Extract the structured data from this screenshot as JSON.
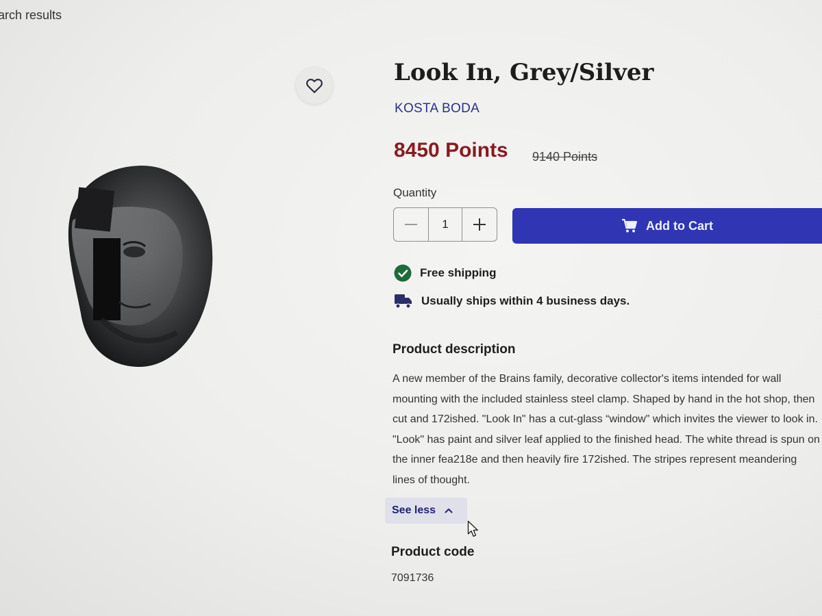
{
  "nav": {
    "back_label": "Back to search results"
  },
  "product": {
    "title": "Look In, Grey/Silver",
    "brand": "KOSTA BODA",
    "price": "8450 Points",
    "old_price": "9140 Points",
    "quantity_label": "Quantity",
    "quantity_value": "1",
    "add_to_cart_label": "Add to Cart",
    "shipping": [
      {
        "icon": "check-circle-icon",
        "text": "Free shipping"
      },
      {
        "icon": "truck-icon",
        "text": "Usually ships within 4 business days."
      }
    ],
    "description_heading": "Product description",
    "description": "A new member of the Brains family, decorative collector's items intended for wall mounting with the included stainless steel clamp. Shaped by hand in the hot shop, then cut and 172ished. \"Look In\" has a cut-glass “window\" which invites the viewer to look in. \"Look\" has paint and silver leaf applied to the finished head. The white thread is spun on the inner fea218e and then heavily fire 172ished. The stripes represent meandering lines of thought.",
    "see_less_label": "See less",
    "code_heading": "Product code",
    "code_value": "7091736"
  },
  "colors": {
    "price": "#8a1a1f",
    "brand": "#2a2f8f",
    "cart_button": "#2f35b3",
    "check_green": "#1e6a3a"
  }
}
